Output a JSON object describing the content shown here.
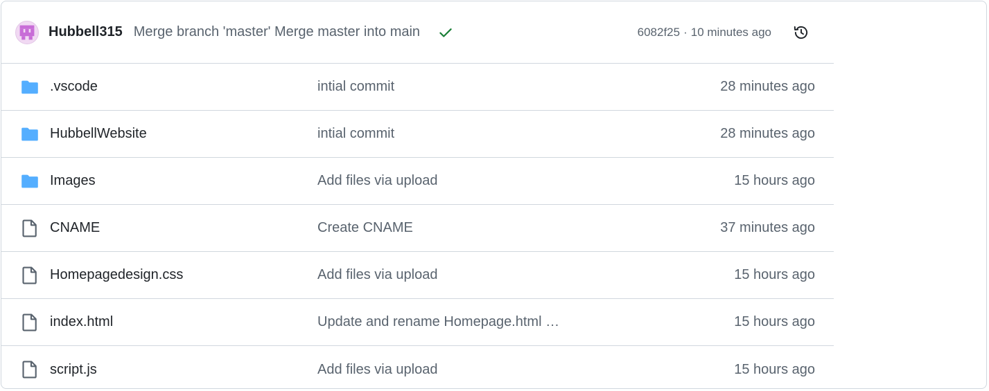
{
  "commit": {
    "author": "Hubbell315",
    "message": "Merge branch 'master' Merge master into main",
    "sha": "6082f25",
    "separator": "·",
    "time": "10 minutes ago",
    "status_icon": "check-icon",
    "history_icon": "history-icon"
  },
  "files": [
    {
      "type": "folder",
      "icon": "folder-icon",
      "name": ".vscode",
      "message": "intial commit",
      "age": "28 minutes ago"
    },
    {
      "type": "folder",
      "icon": "folder-icon",
      "name": "HubbellWebsite",
      "message": "intial commit",
      "age": "28 minutes ago"
    },
    {
      "type": "folder",
      "icon": "folder-icon",
      "name": "Images",
      "message": "Add files via upload",
      "age": "15 hours ago"
    },
    {
      "type": "file",
      "icon": "file-icon",
      "name": "CNAME",
      "message": "Create CNAME",
      "age": "37 minutes ago"
    },
    {
      "type": "file",
      "icon": "file-icon",
      "name": "Homepagedesign.css",
      "message": "Add files via upload",
      "age": "15 hours ago"
    },
    {
      "type": "file",
      "icon": "file-icon",
      "name": "index.html",
      "message": "Update and rename Homepage.html …",
      "age": "15 hours ago"
    },
    {
      "type": "file",
      "icon": "file-icon",
      "name": "script.js",
      "message": "Add files via upload",
      "age": "15 hours ago"
    }
  ],
  "colors": {
    "folder": "#54aeff",
    "check": "#1a7f37",
    "border": "#d0d7de",
    "muted": "#59636e",
    "avatar": "#c86dd7"
  }
}
